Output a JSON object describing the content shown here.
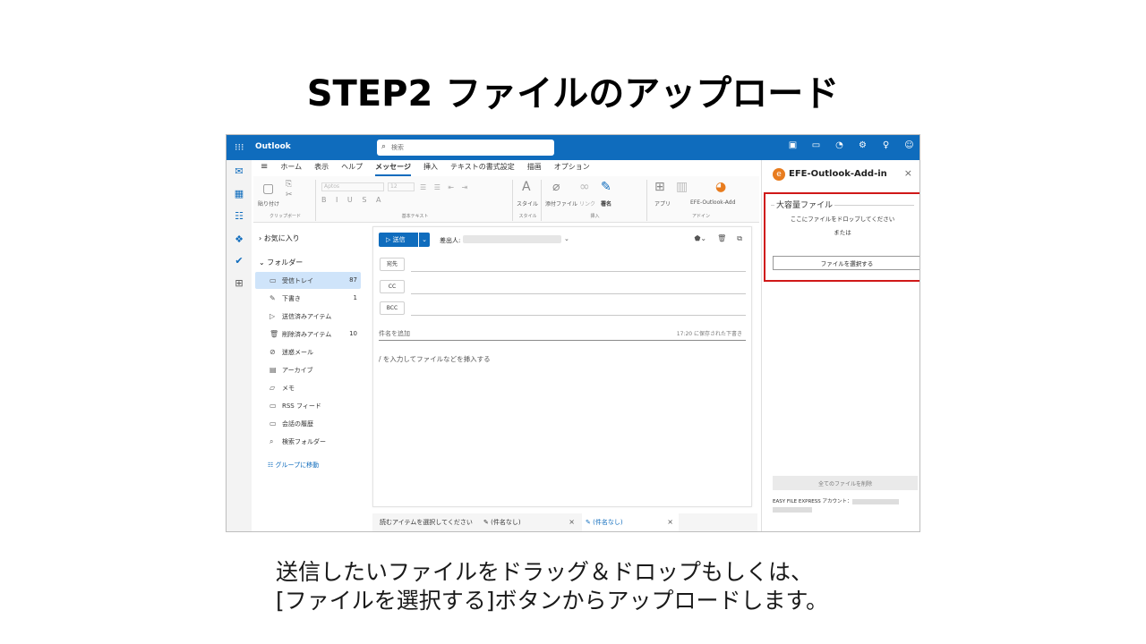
{
  "slide": {
    "title": "STEP2 ファイルのアップロード",
    "caption_line1": "送信したいファイルをドラッグ＆ドロップもしくは、",
    "caption_line2": "[ファイルを選択する]ボタンからアップロードします。"
  },
  "outlook": {
    "app_name": "Outlook",
    "search_placeholder": "検索",
    "accent": "#0f6cbd",
    "ribbon_tabs": [
      "ホーム",
      "表示",
      "ヘルプ",
      "メッセージ",
      "挿入",
      "テキストの書式設定",
      "描画",
      "オプション"
    ],
    "active_ribbon_tab": "メッセージ",
    "ribbon": {
      "clipboard_label": "クリップボード",
      "paste_label": "貼り付け",
      "font_placeholder": "Aptos",
      "font_size": "12",
      "basic_text_label": "基本テキスト",
      "styles_item": "スタイル",
      "styles_label": "スタイル",
      "attach_file": "添付ファイル",
      "link": "リンク",
      "signature": "署名",
      "insert_label": "挿入",
      "apps": "アプリ",
      "addin_item": "EFE-Outlook-Add",
      "addin_group_label": "アドイン"
    },
    "folders": {
      "favorites": "お気に入り",
      "folders_header": "フォルダー",
      "items": [
        {
          "label": "受信トレイ",
          "count": "87",
          "icon": "inbox-icon"
        },
        {
          "label": "下書き",
          "count": "1",
          "icon": "draft-icon"
        },
        {
          "label": "送信済みアイテム",
          "count": "",
          "icon": "sent-icon"
        },
        {
          "label": "削除済みアイテム",
          "count": "10",
          "icon": "trash-icon"
        },
        {
          "label": "迷惑メール",
          "count": "",
          "icon": "junk-icon"
        },
        {
          "label": "アーカイブ",
          "count": "",
          "icon": "archive-icon"
        },
        {
          "label": "メモ",
          "count": "",
          "icon": "note-icon"
        },
        {
          "label": "RSS フィード",
          "count": "",
          "icon": "rss-icon"
        },
        {
          "label": "会話の履歴",
          "count": "",
          "icon": "history-icon"
        },
        {
          "label": "検索フォルダー",
          "count": "",
          "icon": "search-folder-icon"
        }
      ],
      "group_link": "グループに移動"
    },
    "compose": {
      "send_label": "送信",
      "from_label": "差出人:",
      "to_label": "宛先",
      "cc_label": "CC",
      "bcc_label": "BCC",
      "subject_placeholder": "件名を追加",
      "saved_text": "17:20 に保存された下書き",
      "body_hint": "/ を入力してファイルなどを挿入する"
    },
    "bottom_tabs": [
      {
        "label": "読むアイテムを選択してください"
      },
      {
        "label": "(件名なし)"
      },
      {
        "label": "(件名なし)"
      }
    ]
  },
  "addin": {
    "title": "EFE-Outlook-Add-in",
    "section_title": "大容量ファイル",
    "drop_text": "ここにファイルをドロップしてください",
    "or_text": "または",
    "select_button": "ファイルを選択する",
    "delete_all_button": "全てのファイルを削除",
    "account_label": "EASY FILE EXPRESS アカウント：",
    "highlight_color": "#d01818"
  }
}
